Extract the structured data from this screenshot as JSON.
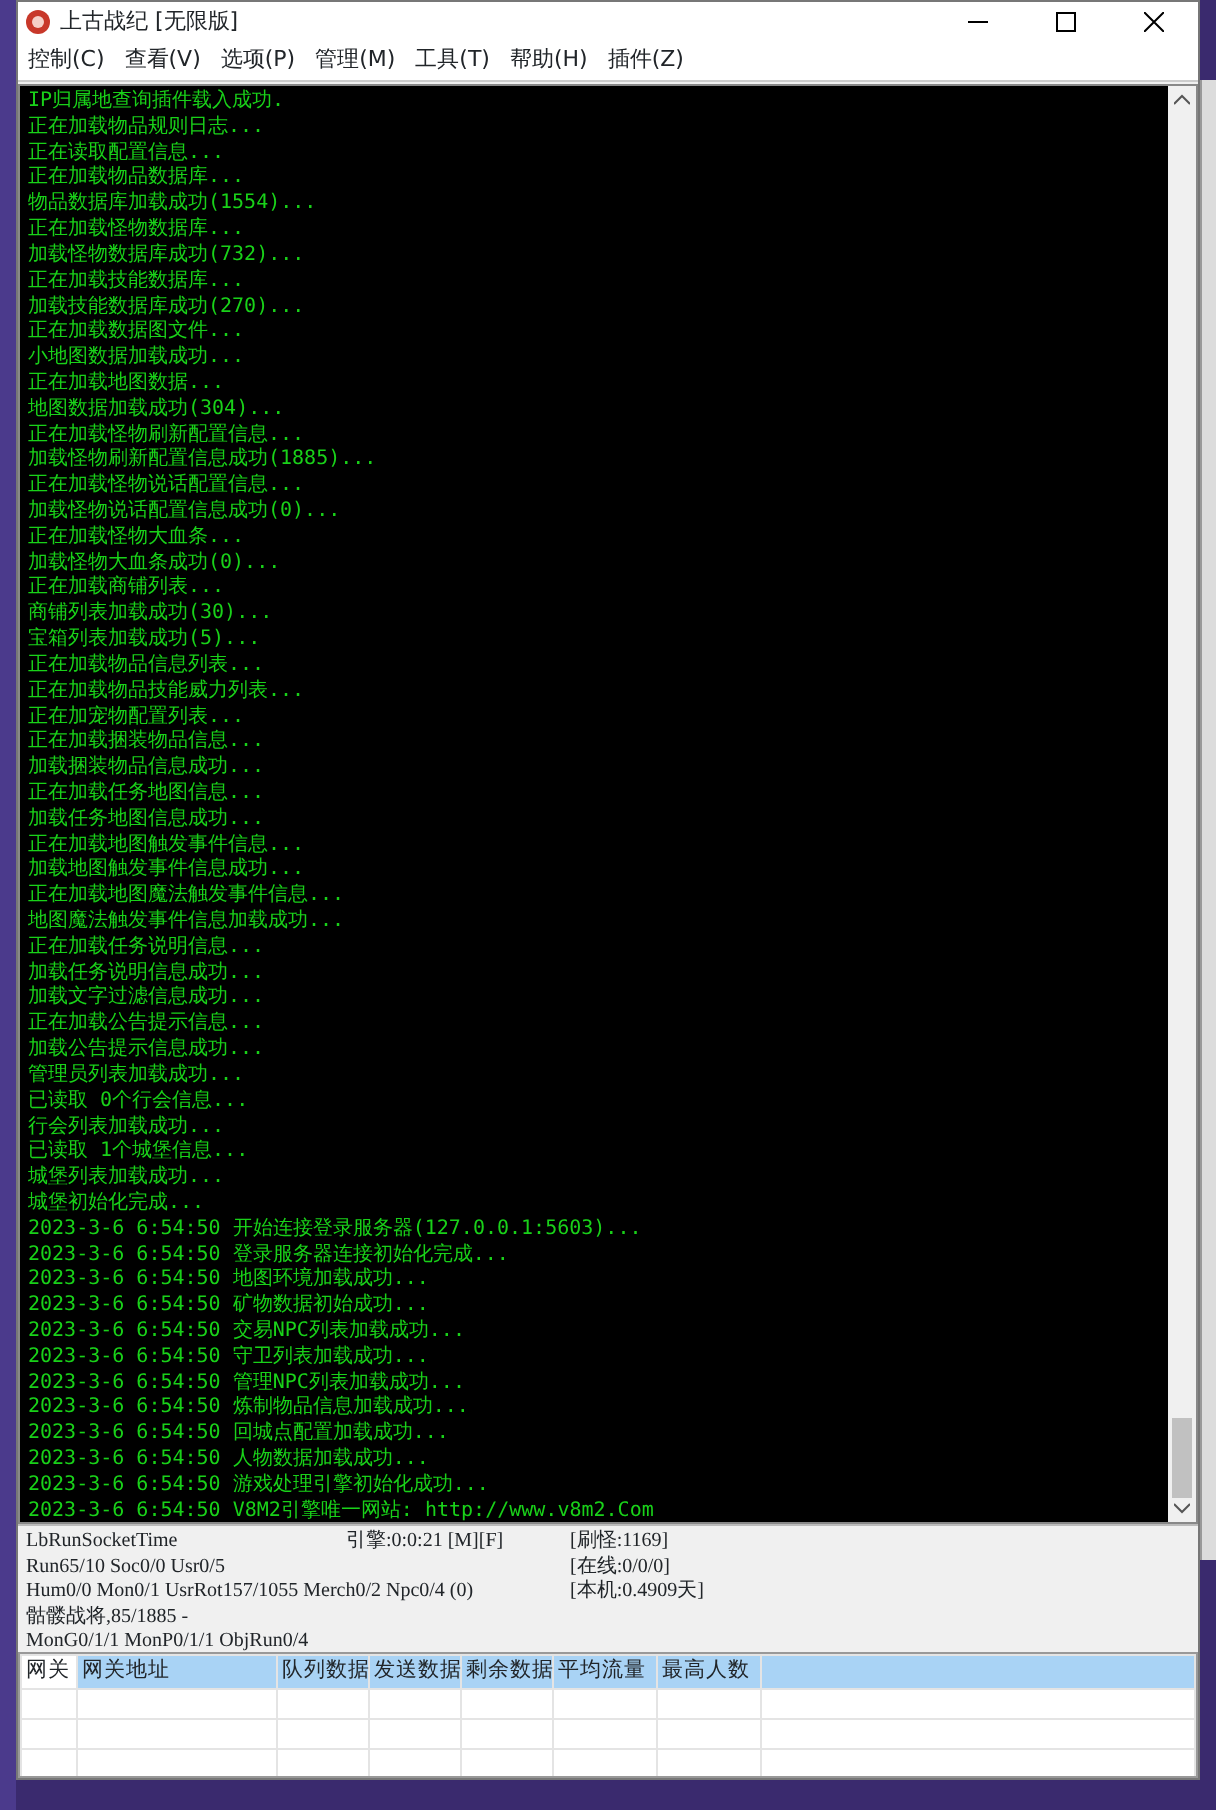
{
  "window": {
    "title": "上古战纪 [无限版]"
  },
  "menu": [
    "控制(C)",
    "查看(V)",
    "选项(P)",
    "管理(M)",
    "工具(T)",
    "帮助(H)",
    "插件(Z)"
  ],
  "log": [
    "IP归属地查询插件载入成功.",
    "正在加载物品规则日志...",
    "正在读取配置信息...",
    "正在加载物品数据库...",
    "物品数据库加载成功(1554)...",
    "正在加载怪物数据库...",
    "加载怪物数据库成功(732)...",
    "正在加载技能数据库...",
    "加载技能数据库成功(270)...",
    "正在加载数据图文件...",
    "小地图数据加载成功...",
    "正在加载地图数据...",
    "地图数据加载成功(304)...",
    "正在加载怪物刷新配置信息...",
    "加载怪物刷新配置信息成功(1885)...",
    "正在加载怪物说话配置信息...",
    "加载怪物说话配置信息成功(0)...",
    "正在加载怪物大血条...",
    "加载怪物大血条成功(0)...",
    "正在加载商铺列表...",
    "商铺列表加载成功(30)...",
    "宝箱列表加载成功(5)...",
    "正在加载物品信息列表...",
    "正在加载物品技能威力列表...",
    "正在加宠物配置列表...",
    "正在加载捆装物品信息...",
    "加载捆装物品信息成功...",
    "正在加载任务地图信息...",
    "加载任务地图信息成功...",
    "正在加载地图触发事件信息...",
    "加载地图触发事件信息成功...",
    "正在加载地图魔法触发事件信息...",
    "地图魔法触发事件信息加载成功...",
    "正在加载任务说明信息...",
    "加载任务说明信息成功...",
    "加载文字过滤信息成功...",
    "正在加载公告提示信息...",
    "加载公告提示信息成功...",
    "管理员列表加载成功...",
    "已读取 0个行会信息...",
    "行会列表加载成功...",
    "已读取 1个城堡信息...",
    "城堡列表加载成功...",
    "城堡初始化完成...",
    "2023-3-6 6:54:50 开始连接登录服务器(127.0.0.1:5603)...",
    "2023-3-6 6:54:50 登录服务器连接初始化完成...",
    "2023-3-6 6:54:50 地图环境加载成功...",
    "2023-3-6 6:54:50 矿物数据初始成功...",
    "2023-3-6 6:54:50 交易NPC列表加载成功...",
    "2023-3-6 6:54:50 守卫列表加载成功...",
    "2023-3-6 6:54:50 管理NPC列表加载成功...",
    "2023-3-6 6:54:50 炼制物品信息加载成功...",
    "2023-3-6 6:54:50 回城点配置加载成功...",
    "2023-3-6 6:54:50 人物数据加载成功...",
    "2023-3-6 6:54:50 游戏处理引擎初始化成功...",
    "2023-3-6 6:54:50 V8M2引擎唯一网站: http://www.v8m2.Com"
  ],
  "status": {
    "left": [
      "LbRunSocketTime",
      "Run65/10 Soc0/0 Usr0/5",
      "Hum0/0 Mon0/1 UsrRot157/1055 Merch0/2 Npc0/4 (0)",
      "骷髅战将,85/1885 -",
      "MonG0/1/1 MonP0/1/1 ObjRun0/4"
    ],
    "engine": "引擎:0:0:21 [M][F]",
    "right": [
      "[刷怪:1169]",
      "[在线:0/0/0]",
      "[本机:0.4909天]"
    ]
  },
  "table": {
    "columns": [
      "网关",
      "网关地址",
      "队列数据",
      "发送数据",
      "剩余数据",
      "平均流量",
      "最高人数"
    ]
  }
}
